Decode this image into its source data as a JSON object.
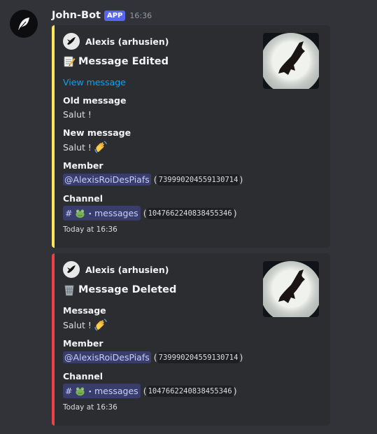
{
  "message": {
    "username": "John-Bot",
    "badge": "APP",
    "time": "16:36"
  },
  "embeds": [
    {
      "author": "Alexis (arhusien)",
      "title": "Message Edited",
      "title_icon": "memo-icon",
      "link": "View message",
      "fields": {
        "old_label": "Old message",
        "old_value": "Salut !",
        "new_label": "New message",
        "new_value": "Salut !",
        "member_label": "Member",
        "member_mention": "@AlexisRoiDesPiafs",
        "member_id": "739990204559130714",
        "channel_label": "Channel",
        "channel_name": "messages",
        "channel_id": "1047662240838455346"
      },
      "footer": "Today at 16:36",
      "color": "#fee75c"
    },
    {
      "author": "Alexis (arhusien)",
      "title": "Message Deleted",
      "title_icon": "wastebasket-icon",
      "fields": {
        "message_label": "Message",
        "message_value": "Salut !",
        "member_label": "Member",
        "member_mention": "@AlexisRoiDesPiafs",
        "member_id": "739990204559130714",
        "channel_label": "Channel",
        "channel_name": "messages",
        "channel_id": "1047662240838455346"
      },
      "footer": "Today at 16:36",
      "color": "#ed4245"
    }
  ],
  "symbols": {
    "open_paren": "(",
    "close_paren": ")",
    "hash": "#",
    "dot": "・"
  },
  "colors": {
    "background": "#313338",
    "embed_bg": "#2b2d31",
    "edited_bar": "#fee75c",
    "deleted_bar": "#ed4245",
    "link": "#00a8fc",
    "app_badge": "#5865f2"
  }
}
